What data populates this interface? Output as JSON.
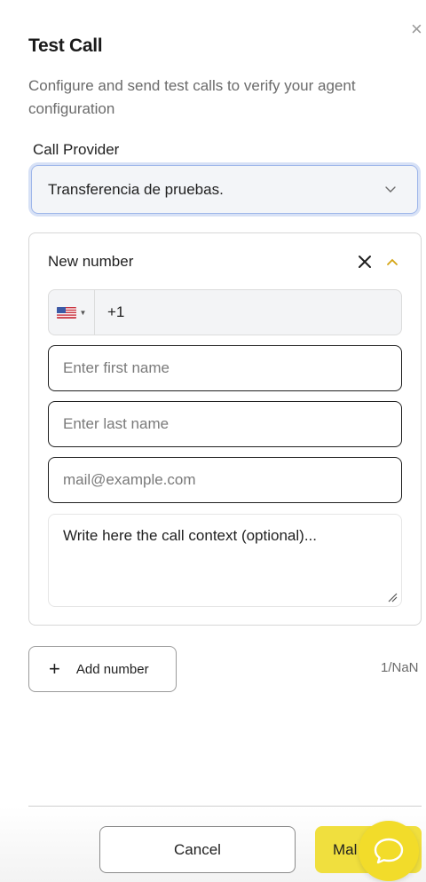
{
  "dialog": {
    "title": "Test Call",
    "subtitle": "Configure and send test calls to verify your agent configuration"
  },
  "provider": {
    "label": "Call Provider",
    "selected": "Transferencia de pruebas."
  },
  "number_card": {
    "title": "New number",
    "country_code": "+1",
    "first_name_placeholder": "Enter first name",
    "last_name_placeholder": "Enter last name",
    "email_placeholder": "mail@example.com",
    "context_placeholder": "Write here the call context (optional)..."
  },
  "actions": {
    "add_number_label": "Add number",
    "counter": "1/NaN",
    "cancel_label": "Cancel",
    "make_label": "Mal"
  },
  "colors": {
    "accent_yellow": "#f0df3e",
    "select_focus": "#9fb7ea"
  }
}
